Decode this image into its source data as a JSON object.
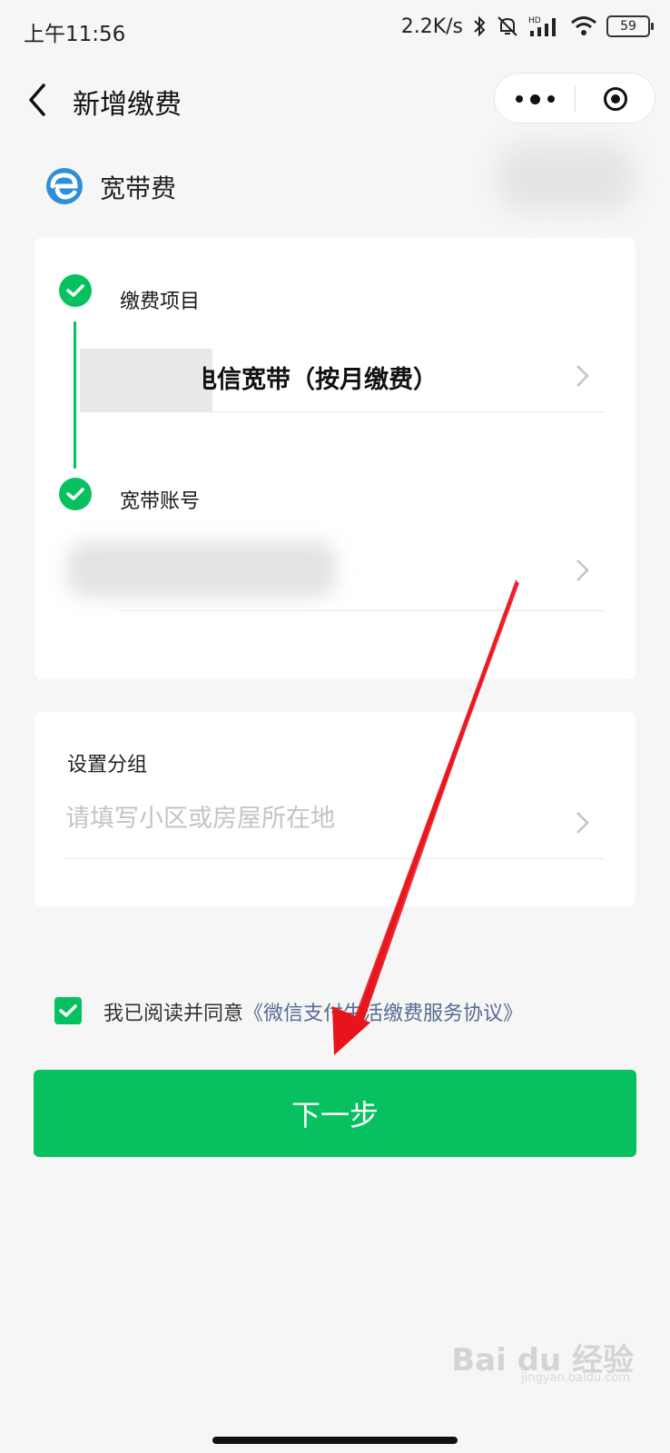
{
  "status_bar": {
    "time": "上午11:56",
    "speed": "2.2K/s",
    "battery": "59",
    "icons": [
      "bluetooth-icon",
      "mute-icon",
      "hd-signal-icon",
      "wifi-icon",
      "battery-icon"
    ]
  },
  "nav": {
    "title": "新增缴费"
  },
  "service": {
    "name": "宽带费",
    "icon": "browser-e-icon",
    "icon_color": "#2d8fd8"
  },
  "steps": [
    {
      "label": "缴费项目",
      "value": "电信宽带（按月缴费）"
    },
    {
      "label": "宽带账号",
      "value": ""
    }
  ],
  "group": {
    "label": "设置分组",
    "placeholder": "请填写小区或房屋所在地"
  },
  "agreement": {
    "prefix": "我已阅读并同意",
    "link": "《微信支付生活缴费服务协议》",
    "checked": true
  },
  "next_button": "下一步",
  "watermark": {
    "brand": "Bai du 经验",
    "site": "jingyan.baidu.com"
  },
  "colors": {
    "accent": "#07c160",
    "link": "#576b95",
    "annotation_arrow": "#e8141c"
  }
}
